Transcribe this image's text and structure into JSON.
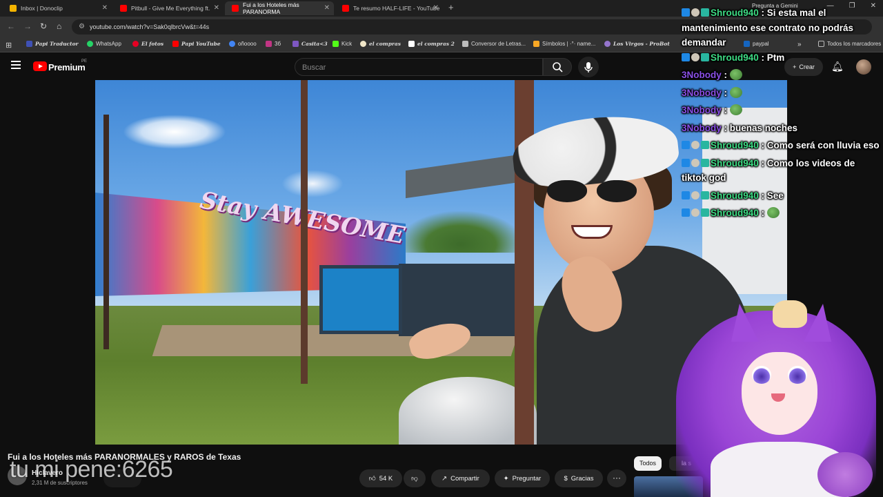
{
  "browser": {
    "tabs": [
      {
        "label": "Inbox | Donoclip",
        "color": "#f4b400"
      },
      {
        "label": "Pitbull - Give Me Everything ft.",
        "color": "#ff0000"
      },
      {
        "label": "Fui a los Hoteles más PARANORMA",
        "color": "#ff0000",
        "active": true
      },
      {
        "label": "Te resumo HALF-LIFE - YouTube",
        "color": "#ff0000"
      }
    ],
    "url": "youtube.com/watch?v=Sak0qlbrcVw&t=44s",
    "gemini": "Pregunta a Gemini",
    "bookmarks": [
      {
        "label": "Papi Traductor",
        "italic": true,
        "color": "#3f51b5"
      },
      {
        "label": "WhatsApp",
        "color": "#25d366"
      },
      {
        "label": "El fotos",
        "italic": true,
        "color": "#e60023"
      },
      {
        "label": "Papi YouTube",
        "italic": true,
        "color": "#ff0000"
      },
      {
        "label": "oñoooo",
        "color": "#4285f4"
      },
      {
        "label": "3б",
        "color": "#c13584"
      },
      {
        "label": "Casita<3",
        "italic": true,
        "color": "#7e57c2"
      },
      {
        "label": "Kick",
        "color": "#53fc18"
      },
      {
        "label": "el compras",
        "italic": true,
        "color": "#f0e6c8"
      },
      {
        "label": "el compras 2",
        "italic": true,
        "color": "#ffffff"
      },
      {
        "label": "Conversor de Letras...",
        "color": "#bdbdbd"
      },
      {
        "label": "Símbolos | ·°· name...",
        "color": "#f9a825"
      },
      {
        "label": "Los Virgos - ProBot",
        "italic": true,
        "color": "#9575cd"
      },
      {
        "label": "paypal",
        "color": "#1565c0"
      }
    ],
    "all_bookmarks": "Todos los marcadores"
  },
  "youtube": {
    "logo_text": "Premium",
    "country": "PE",
    "search_placeholder": "Buscar",
    "create_label": "Crear"
  },
  "video": {
    "title": "Fui a los Hoteles más PARANORMALES y RAROS de Texas",
    "mural_text": "Stay AWESOME",
    "channel_name": "Hiclavero",
    "subscribers": "2,31 M de suscriptores",
    "likes": "54 K",
    "share_label": "Compartir",
    "ask_label": "Preguntar",
    "thanks_label": "Gracias",
    "more_label": "···"
  },
  "overlay_text": "tu mi pene:6265",
  "chips": {
    "all": "Todos",
    "second": "la s"
  },
  "chat": [
    {
      "user": "Shroud940",
      "badges": true,
      "text": "Si esta mal el mantenimiento ese contrato no podrás demandar"
    },
    {
      "user": "Shroud940",
      "badges": true,
      "text": "Ptm"
    },
    {
      "user": "3Nobody",
      "badges": false,
      "text": "",
      "emote": true
    },
    {
      "user": "3Nobody",
      "badges": false,
      "text": "",
      "emote": true
    },
    {
      "user": "3Nobody",
      "badges": false,
      "text": "",
      "emote": true
    },
    {
      "user": "3Nobody",
      "badges": false,
      "text": "buenas noches"
    },
    {
      "user": "Shroud940",
      "badges": true,
      "text": "Como será con lluvia eso"
    },
    {
      "user": "Shroud940",
      "badges": true,
      "text": "Como los videos de tiktok god"
    },
    {
      "user": "Shroud940",
      "badges": true,
      "text": "See"
    },
    {
      "user": "Shroud940",
      "badges": true,
      "text": "",
      "emote": true
    }
  ]
}
